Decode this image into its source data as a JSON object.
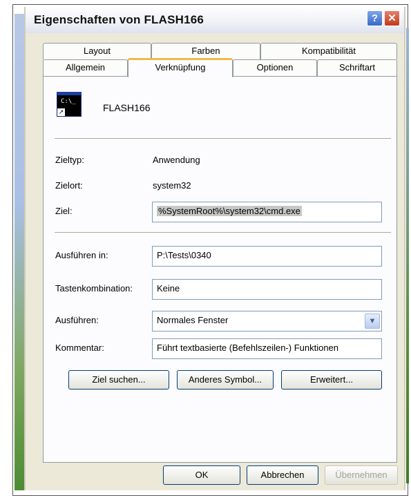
{
  "window": {
    "title": "Eigenschaften von FLASH166",
    "help_label": "?",
    "close_label": "✕"
  },
  "tabs": {
    "row1": [
      "Layout",
      "Farben",
      "Kompatibilität"
    ],
    "row2": [
      "Allgemein",
      "Verknüpfung",
      "Optionen",
      "Schriftart"
    ],
    "active": "Verknüpfung"
  },
  "shortcut": {
    "icon": "cmd-console-icon",
    "icon_prompt": "C:\\_",
    "name": "FLASH166",
    "fields": {
      "zieltyp_label": "Zieltyp:",
      "zieltyp_value": "Anwendung",
      "zielort_label": "Zielort:",
      "zielort_value": "system32",
      "ziel_label": "Ziel:",
      "ziel_value": "%SystemRoot%\\system32\\cmd.exe",
      "ausfuehren_in_label": "Ausführen in:",
      "ausfuehren_in_value": "P:\\Tests\\0340",
      "tastenkombination_label": "Tastenkombination:",
      "tastenkombination_value": "Keine",
      "ausfuehren_label": "Ausführen:",
      "ausfuehren_value": "Normales Fenster",
      "kommentar_label": "Kommentar:",
      "kommentar_value": "Führt textbasierte (Befehlszeilen-) Funktionen"
    },
    "buttons": {
      "ziel_suchen": "Ziel suchen...",
      "anderes_symbol": "Anderes Symbol...",
      "erweitert": "Erweitert..."
    }
  },
  "footer": {
    "ok": "OK",
    "abbrechen": "Abbrechen",
    "uebernehmen": "Übernehmen"
  },
  "colors": {
    "dialog_bg": "#ece9d8",
    "active_tab_highlight": "#f0b84a",
    "button_border": "#003c74",
    "close_button": "#c2391d"
  }
}
